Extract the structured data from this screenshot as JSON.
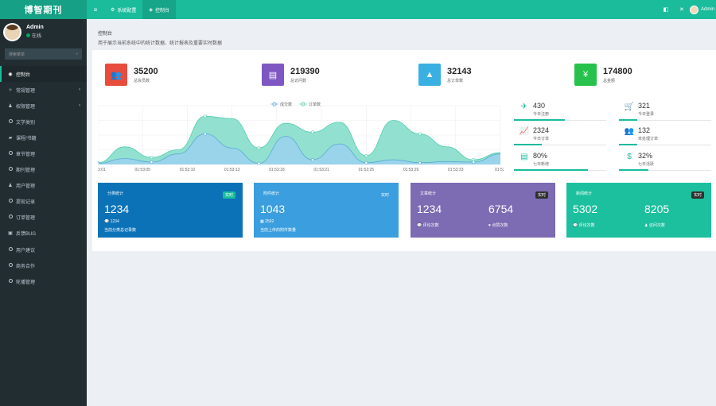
{
  "app": {
    "logo": "博智期刊"
  },
  "topbar": {
    "menu_icon": "≡",
    "tabs": [
      {
        "icon": "⚙",
        "label": "系统配置"
      },
      {
        "icon": "◈",
        "label": "控制台"
      }
    ],
    "right_icons": [
      "◧",
      "✕"
    ],
    "user_name": "Admin"
  },
  "sidebar": {
    "user_name": "Admin",
    "status": "在线",
    "search_placeholder": "搜索菜单",
    "items": [
      {
        "icon": "◉",
        "label": "控制台",
        "chev": ""
      },
      {
        "icon": "✧",
        "label": "常规管理",
        "chev": "‹"
      },
      {
        "icon": "♟",
        "label": "权限管理",
        "chev": "‹"
      },
      {
        "icon": "○",
        "label": "文学类别",
        "chev": ""
      },
      {
        "icon": "○",
        "label": "课程/书籍",
        "chev": ""
      },
      {
        "icon": "○",
        "label": "章节管理",
        "chev": ""
      },
      {
        "icon": "○",
        "label": "期刊管理",
        "chev": ""
      },
      {
        "icon": "♟",
        "label": "用户管理",
        "chev": ""
      },
      {
        "icon": "○",
        "label": "提现记录",
        "chev": ""
      },
      {
        "icon": "○",
        "label": "订单管理",
        "chev": ""
      },
      {
        "icon": "▣",
        "label": "反馈BUG",
        "chev": ""
      },
      {
        "icon": "○",
        "label": "用户建议",
        "chev": ""
      },
      {
        "icon": "○",
        "label": "商务合作",
        "chev": ""
      },
      {
        "icon": "○",
        "label": "轮播管理",
        "chev": ""
      }
    ]
  },
  "header": {
    "title": "控制台",
    "subtitle": "用于展示当前系统中的统计数据、统计报表及重要实时数据"
  },
  "stats": [
    {
      "icon": "👥",
      "value": "35200",
      "label": "总会员数",
      "color": "#e74c3c"
    },
    {
      "icon": "▤",
      "value": "219390",
      "label": "总访问数",
      "color": "#7e57c2"
    },
    {
      "icon": "▲",
      "value": "32143",
      "label": "总订单数",
      "color": "#3ab0e2"
    },
    {
      "icon": "¥",
      "value": "174800",
      "label": "总金额",
      "color": "#27c24c"
    }
  ],
  "mini_stats": [
    {
      "icon": "✈",
      "value": "430",
      "label": "今日注册",
      "progress": 0.55
    },
    {
      "icon": "🛒",
      "value": "321",
      "label": "今日登录",
      "progress": 0.2
    },
    {
      "icon": "📈",
      "value": "2324",
      "label": "今日订单",
      "progress": 0.3
    },
    {
      "icon": "👥",
      "value": "132",
      "label": "未处理订单",
      "progress": 0.2
    },
    {
      "icon": "▤",
      "value": "80%",
      "label": "七日新增",
      "progress": 0.8
    },
    {
      "icon": "$",
      "value": "32%",
      "label": "七日活跃",
      "progress": 0.32
    }
  ],
  "chart_data": {
    "type": "area",
    "legend": [
      "成交数",
      "订单数"
    ],
    "x": [
      "3:01",
      "01:53:05",
      "01:53:10",
      "01:53:13",
      "01:53:18",
      "01:53:21",
      "01:53:25",
      "01:53:29",
      "01:53:33",
      "01:53:"
    ],
    "series": [
      {
        "name": "成交数",
        "values": [
          2,
          10,
          4,
          18,
          52,
          28,
          2,
          48,
          8,
          35,
          3,
          8,
          3,
          5,
          4,
          18
        ]
      },
      {
        "name": "订单数",
        "values": [
          3,
          30,
          12,
          25,
          82,
          78,
          28,
          70,
          55,
          72,
          15,
          75,
          52,
          30,
          8,
          20
        ]
      }
    ],
    "colors": {
      "deal": "#9ad1ef",
      "order": "#7fdbc7"
    }
  },
  "cards": [
    {
      "title": "分类统计",
      "badge": "实时",
      "color": "#0b72b8",
      "badge_color": "#1abc9c",
      "value1": "1234",
      "value2": "",
      "sub1": "💬 1234",
      "sub2": "当前分类总记录数"
    },
    {
      "title": "附件统计",
      "badge": "实时",
      "color": "#3b9ede",
      "badge_color": "#3b9ede",
      "value1": "1043",
      "value2": "",
      "sub1": "▦ 2592",
      "sub2": "当前上传的附件数量"
    },
    {
      "title": "文章统计",
      "badge": "实时",
      "color": "#7d6bb3",
      "badge_color": "#2f2f2f",
      "value1": "1234",
      "value2": "6754",
      "sub1": "💬 评论次数",
      "sub2": "♥ 点赞次数"
    },
    {
      "title": "新闻统计",
      "badge": "实时",
      "color": "#1cc09e",
      "badge_color": "#2f2f2f",
      "value1": "5302",
      "value2": "8205",
      "sub1": "💬 评论次数",
      "sub2": "♟ 访问次数"
    }
  ]
}
